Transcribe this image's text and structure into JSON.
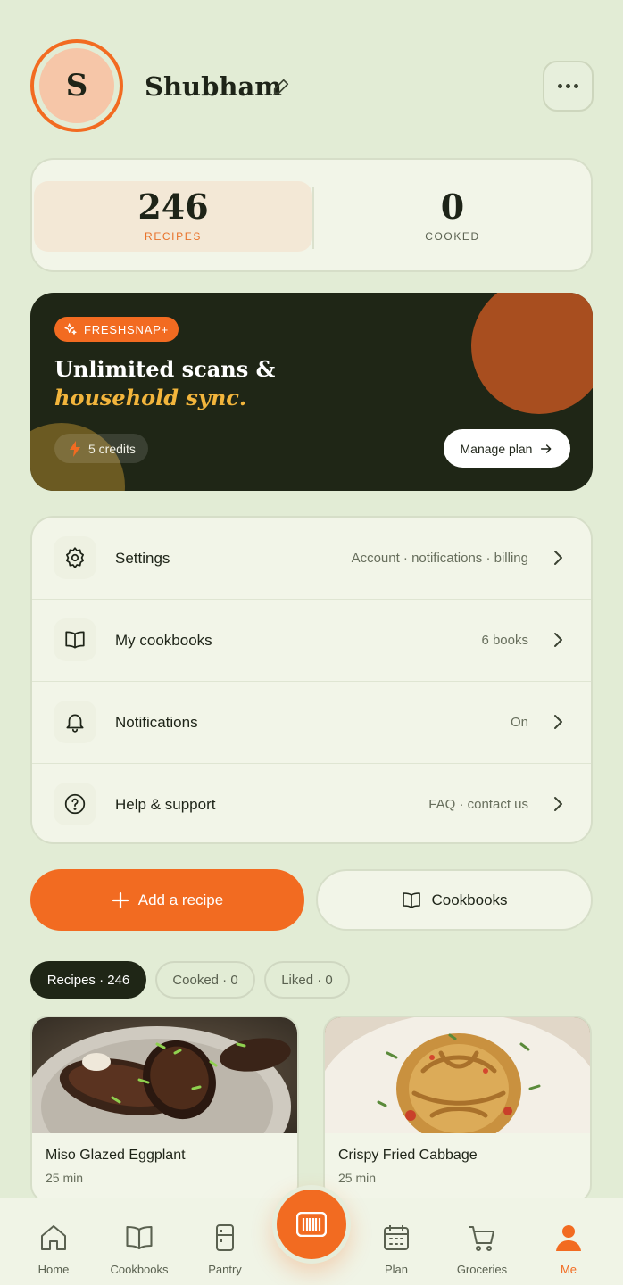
{
  "profile": {
    "initial": "S",
    "name": "Shubham"
  },
  "stats": {
    "recipes_count": "246",
    "recipes_label": "RECIPES",
    "cooked_count": "0",
    "cooked_label": "COOKED"
  },
  "promo": {
    "badge": "FRESHSNAP+",
    "title_line1": "Unlimited scans &",
    "title_line2": "household sync.",
    "credits": "5 credits",
    "manage_label": "Manage plan"
  },
  "menu": {
    "items": [
      {
        "label": "Settings",
        "value": "Account · notifications · billing"
      },
      {
        "label": "My cookbooks",
        "value": "6 books"
      },
      {
        "label": "Notifications",
        "value": "On"
      },
      {
        "label": "Help & support",
        "value": "FAQ · contact us"
      }
    ]
  },
  "actions": {
    "add_recipe": "Add a recipe",
    "cookbooks": "Cookbooks"
  },
  "filters": [
    {
      "label": "Recipes · 246",
      "active": true
    },
    {
      "label": "Cooked · 0",
      "active": false
    },
    {
      "label": "Liked · 0",
      "active": false
    }
  ],
  "recipes": [
    {
      "title": "Miso Glazed Eggplant",
      "time": "25 min"
    },
    {
      "title": "Crispy Fried Cabbage",
      "time": "25 min"
    }
  ],
  "nav": {
    "items": [
      {
        "label": "Home",
        "icon": "home-icon"
      },
      {
        "label": "Cookbooks",
        "icon": "book-icon"
      },
      {
        "label": "Pantry",
        "icon": "fridge-icon"
      },
      {
        "label": "Plan",
        "icon": "calendar-icon"
      },
      {
        "label": "Groceries",
        "icon": "cart-icon"
      },
      {
        "label": "Me",
        "icon": "person-icon"
      }
    ],
    "active": "Me",
    "scan_icon": "barcode-scan-icon"
  },
  "colors": {
    "accent": "#f26b21",
    "background": "#e2ecd5",
    "dark": "#1f2616",
    "highlight": "#f2b53c"
  }
}
